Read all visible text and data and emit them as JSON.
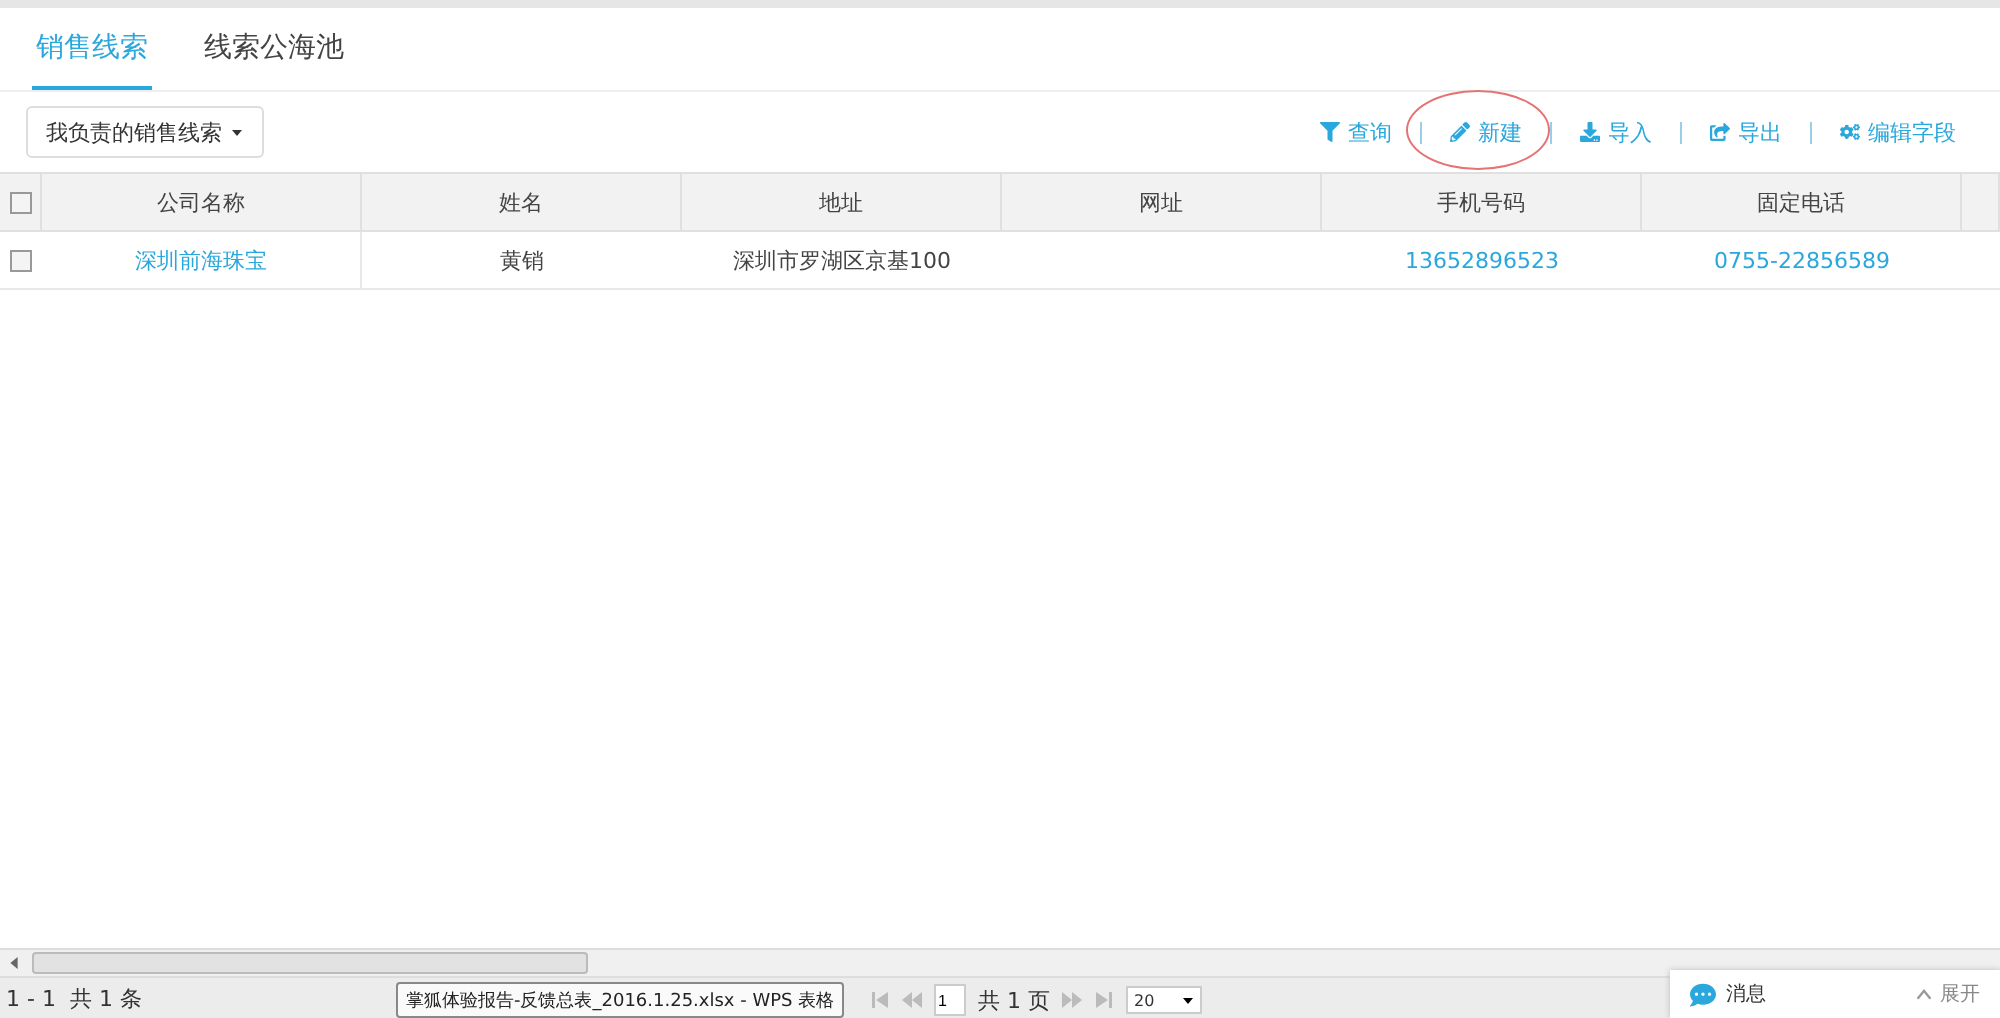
{
  "tabs": [
    {
      "label": "销售线索",
      "selected": true
    },
    {
      "label": "线索公海池",
      "selected": false
    }
  ],
  "filter_dropdown": {
    "label": "我负责的销售线索"
  },
  "toolbar": [
    {
      "kind": "filter",
      "label": "查询",
      "highlighted": false
    },
    {
      "kind": "edit",
      "label": "新建",
      "highlighted": true
    },
    {
      "kind": "download",
      "label": "导入",
      "highlighted": false
    },
    {
      "kind": "export",
      "label": "导出",
      "highlighted": false
    },
    {
      "kind": "settings",
      "label": "编辑字段",
      "highlighted": false
    }
  ],
  "table": {
    "all_checked": false,
    "columns": [
      "公司名称",
      "姓名",
      "地址",
      "网址",
      "手机号码",
      "固定电话"
    ],
    "rows": [
      {
        "checked": false,
        "cells": [
          {
            "text": "深圳前海珠宝",
            "link": true
          },
          {
            "text": "黄销",
            "link": false
          },
          {
            "text": "深圳市罗湖区京基100",
            "link": false
          },
          {
            "text": ""
          },
          {
            "text": "13652896523",
            "link": true
          },
          {
            "text": "0755-22856589",
            "link": true
          }
        ]
      }
    ]
  },
  "footer": {
    "summary": "1 - 1  共 1 条",
    "page": "1",
    "total_pages": "共 1 页",
    "page_size": "20"
  },
  "tooltip": "掌狐体验报告-反馈总表_2016.1.25.xlsx - WPS 表格",
  "message_panel": {
    "title": "消息",
    "toggle": "展开"
  }
}
